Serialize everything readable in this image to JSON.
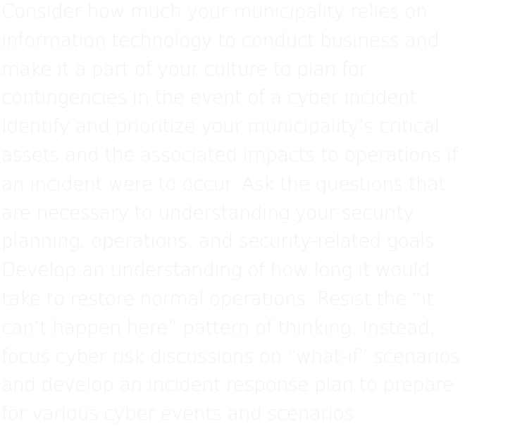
{
  "paragraph": {
    "text": "Consider how much your municipality relies on\ninformation technology to conduct business and\nmake it a part of your culture to plan for\ncontingencies in the event of a cyber incident.\nIdentify and prioritize your municipality’s critical\nassets and the associated impacts to operations if\nan incident were to occur. Ask the questions that\nare necessary to understanding your security\nplanning, operations, and security-related goals.\nDevelop an understanding of how long it would\ntake to restore normal operations. Resist the “it\ncan’t happen here” pattern of thinking. Instead,\nfocus cyber risk discussions on “what-if” scenarios\nand develop an incident response plan to prepare\nfor various cyber events and scenarios.",
    "color": "#f2f2f2"
  }
}
